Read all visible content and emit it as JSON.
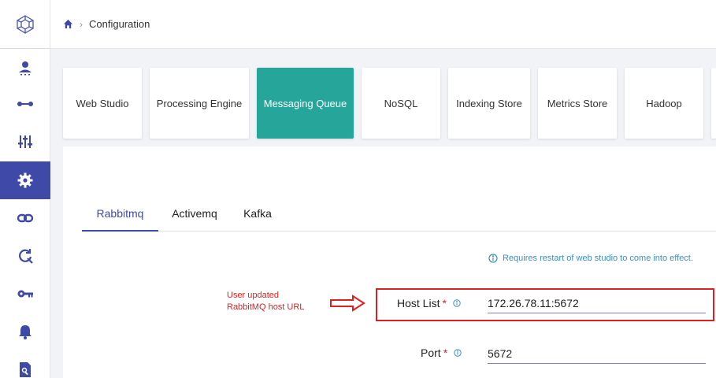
{
  "breadcrumb": {
    "current": "Configuration"
  },
  "categories": [
    {
      "label": "Web Studio",
      "active": false
    },
    {
      "label": "Processing Engine",
      "active": false
    },
    {
      "label": "Messaging Queue",
      "active": true
    },
    {
      "label": "NoSQL",
      "active": false
    },
    {
      "label": "Indexing Store",
      "active": false
    },
    {
      "label": "Metrics Store",
      "active": false
    },
    {
      "label": "Hadoop",
      "active": false
    }
  ],
  "subtabs": [
    {
      "label": "Rabbitmq",
      "active": true
    },
    {
      "label": "Activemq",
      "active": false
    },
    {
      "label": "Kafka",
      "active": false
    }
  ],
  "notice": "Requires restart of web studio to come into effect.",
  "annotation": {
    "line1": "User updated",
    "line2": "RabbitMQ host URL"
  },
  "fields": {
    "host_list": {
      "label": "Host List",
      "required": "*",
      "value": "172.26.78.11:5672"
    },
    "port": {
      "label": "Port",
      "required": "*",
      "value": "5672"
    }
  },
  "colors": {
    "primary": "#3f4aa8",
    "active_tile": "#26a69a",
    "annotation": "#e02020",
    "info": "#3a8fc4"
  },
  "sidebar_icons": [
    "user-icon",
    "pipeline-icon",
    "sliders-icon",
    "gear-icon",
    "link-icon",
    "refresh-search-icon",
    "key-icon",
    "bell-icon",
    "search-document-icon"
  ]
}
